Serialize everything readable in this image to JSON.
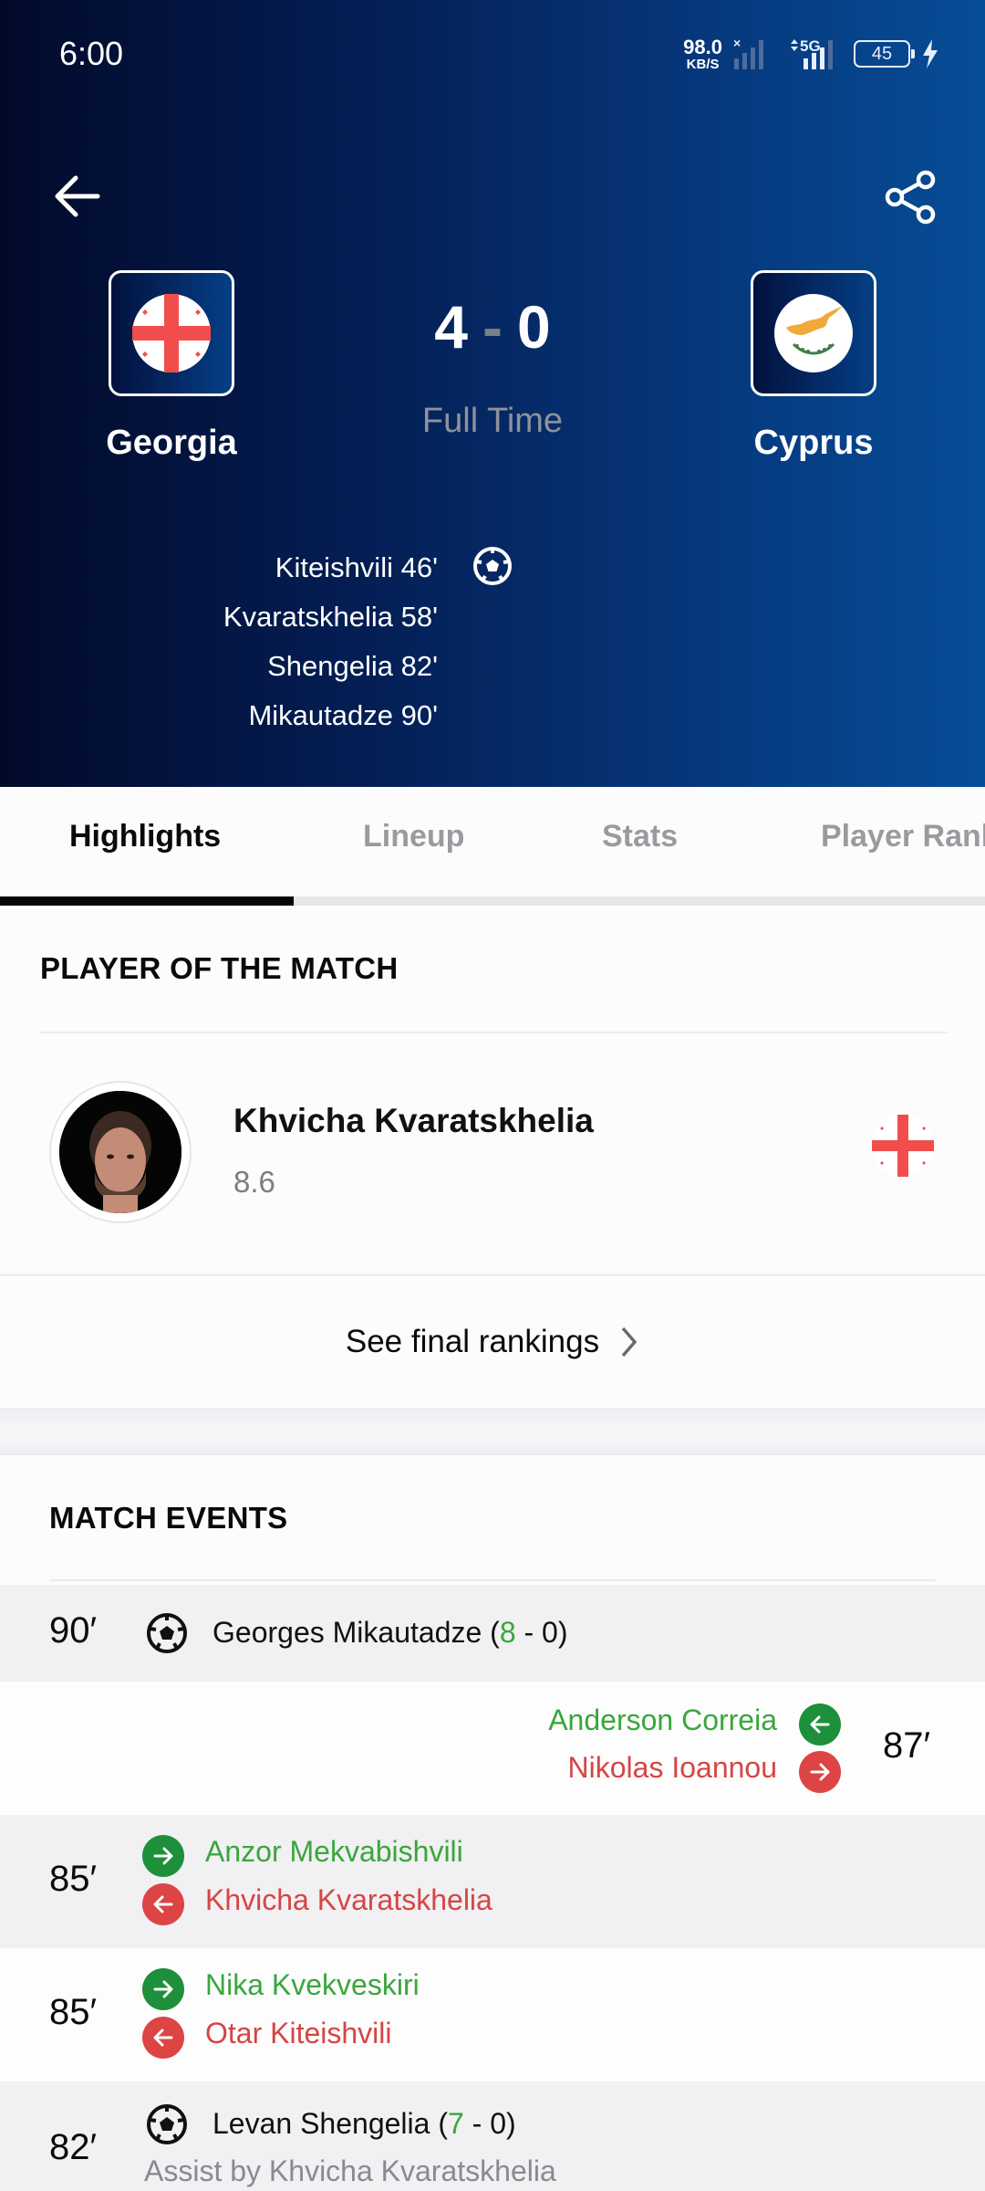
{
  "status_bar": {
    "time": "6:00",
    "net_speed_value": "98.0",
    "net_speed_unit": "KB/S",
    "network_type": "5G",
    "battery_level": "45"
  },
  "header": {
    "back_icon": "arrow-left-icon",
    "share_icon": "share-icon"
  },
  "match": {
    "home_team": {
      "name": "Georgia",
      "score": "4",
      "flag_icon": "georgia-flag-icon"
    },
    "away_team": {
      "name": "Cyprus",
      "score": "0",
      "flag_icon": "cyprus-flag-icon"
    },
    "score_separator": "-",
    "status": "Full Time",
    "home_scorers": [
      {
        "text": "Kiteishvili 46'"
      },
      {
        "text": "Kvaratskhelia 58'"
      },
      {
        "text": "Shengelia 82'"
      },
      {
        "text": "Mikautadze 90'"
      }
    ]
  },
  "tabs": [
    {
      "label": "Highlights",
      "active": true
    },
    {
      "label": "Lineup",
      "active": false
    },
    {
      "label": "Stats",
      "active": false
    },
    {
      "label": "Player Ranl",
      "active": false
    }
  ],
  "player_of_match": {
    "section_title": "PLAYER OF THE MATCH",
    "player_name": "Khvicha Kvaratskhelia",
    "rating": "8.6",
    "team_flag_icon": "georgia-flag-icon"
  },
  "rankings_link": {
    "label": "See final rankings",
    "icon": "chevron-right-icon"
  },
  "match_events": {
    "section_title": "MATCH EVENTS",
    "events": [
      {
        "type": "goal",
        "minute": "90′",
        "side": "home",
        "player": "Georges Mikautadze",
        "score_open": " (",
        "score_home": "8",
        "score_rest": " - 0)"
      },
      {
        "type": "substitution",
        "minute": "87′",
        "side": "away",
        "player_in": "Anderson Correia",
        "player_out": "Nikolas Ioannou"
      },
      {
        "type": "substitution",
        "minute": "85′",
        "side": "home",
        "player_in": "Anzor Mekvabishvili",
        "player_out": "Khvicha Kvaratskhelia"
      },
      {
        "type": "substitution",
        "minute": "85′",
        "side": "home",
        "player_in": "Nika Kvekveskiri",
        "player_out": "Otar Kiteishvili"
      },
      {
        "type": "goal",
        "minute": "82′",
        "side": "home",
        "player": "Levan Shengelia",
        "score_open": " (",
        "score_home": "7",
        "score_rest": " - 0)",
        "assist": "Assist by Khvicha Kvaratskhelia"
      }
    ]
  },
  "colors": {
    "sub_in": "#1e8f3a",
    "sub_out": "#dd4444",
    "text_in": "#3aa63d",
    "text_out": "#d64545",
    "hero_gradient_start": "#020a2a",
    "hero_gradient_end": "#064d97"
  }
}
